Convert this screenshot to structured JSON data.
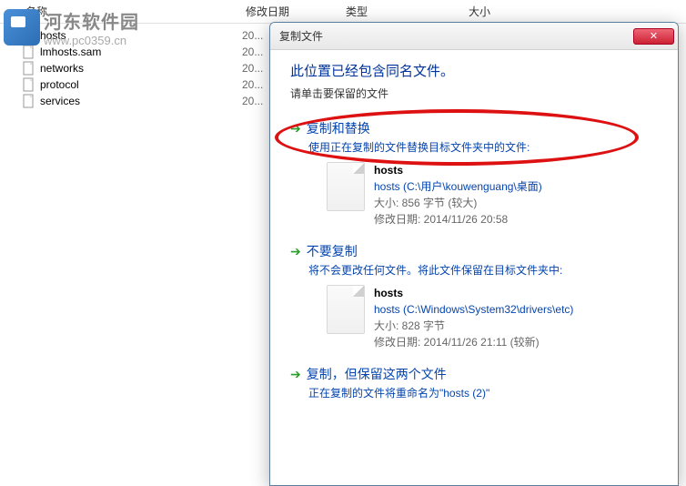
{
  "columns": {
    "name": "名称",
    "date": "修改日期",
    "type": "类型",
    "size": "大小"
  },
  "files": [
    {
      "name": "hosts",
      "date": "20..."
    },
    {
      "name": "lmhosts.sam",
      "date": "20..."
    },
    {
      "name": "networks",
      "date": "20..."
    },
    {
      "name": "protocol",
      "date": "20..."
    },
    {
      "name": "services",
      "date": "20..."
    }
  ],
  "watermark": {
    "title": "河东软件园",
    "url": "www.pc0359.cn"
  },
  "dialog": {
    "title": "复制文件",
    "heading": "此位置已经包含同名文件。",
    "sub": "请单击要保留的文件",
    "opt1": {
      "title": "复制和替换",
      "desc": "使用正在复制的文件替换目标文件夹中的文件:",
      "file": {
        "name": "hosts",
        "path": "hosts (C:\\用户\\kouwenguang\\桌面)",
        "size": "大小: 856 字节 (较大)",
        "date": "修改日期: 2014/11/26 20:58"
      }
    },
    "opt2": {
      "title": "不要复制",
      "desc": "将不会更改任何文件。将此文件保留在目标文件夹中:",
      "file": {
        "name": "hosts",
        "path": "hosts (C:\\Windows\\System32\\drivers\\etc)",
        "size": "大小: 828 字节",
        "date": "修改日期: 2014/11/26 21:11 (较新)"
      }
    },
    "opt3": {
      "title": "复制，但保留这两个文件",
      "desc": "正在复制的文件将重命名为\"hosts (2)\""
    }
  }
}
